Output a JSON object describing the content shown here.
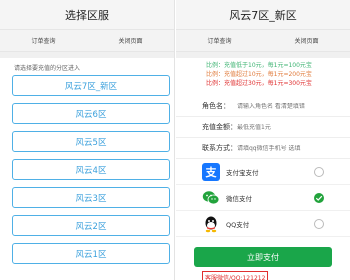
{
  "left": {
    "title": "选择区服",
    "tabs": [
      "订单查询",
      "关闭页面"
    ],
    "hint": "请选择要充值的分区进入",
    "servers": [
      "风云7区_新区",
      "风云6区",
      "风云5区",
      "风云4区",
      "风云3区",
      "风云2区",
      "风云1区"
    ]
  },
  "right": {
    "title": "风云7区_新区",
    "tabs": [
      "订单查询",
      "关闭页面"
    ],
    "notice": [
      "比例：充值低于10元，每1元=100元宝",
      "比例：充值超过10元，每1元=200元宝",
      "比例：充值超过30元，每1元=300元宝"
    ],
    "form": {
      "role_label": "角色名：",
      "role_placeholder": "请输入角色名 看清楚填错",
      "amount_label": "充值金额：",
      "amount_placeholder": "最低充值1元",
      "contact_label": "联系方式：",
      "contact_placeholder": "请填qq微信手机号 选填"
    },
    "payments": [
      {
        "label": "支付宝支付",
        "icon": "alipay-icon",
        "selected": false
      },
      {
        "label": "微信支付",
        "icon": "wechat-pay-icon",
        "selected": true
      },
      {
        "label": "QQ支付",
        "icon": "qq-pay-icon",
        "selected": false
      }
    ],
    "pay_button": "立即支付",
    "service": "客服微信/QQ:121212"
  },
  "colors": {
    "accent": "#4fb0e6",
    "pay_green": "#1aa64a",
    "alipay": "#1677ff",
    "wechat": "#22a33c",
    "warning": "#e03030"
  }
}
